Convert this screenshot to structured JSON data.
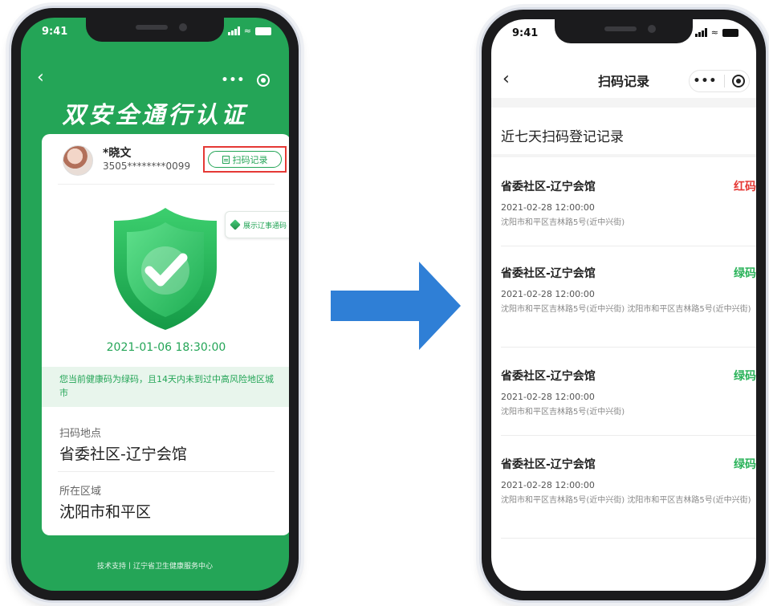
{
  "left_phone": {
    "status_time": "9:41",
    "title": "双安全通行认证",
    "user": {
      "name": "*晓文",
      "id_masked": "3505********0099"
    },
    "record_button_label": "扫码记录",
    "show_code_label": "展示辽事通码",
    "timestamp": "2021-01-06 18:30:00",
    "notice": "您当前健康码为绿码，且14天内未到过中高风险地区城市",
    "fields": [
      {
        "label": "扫码地点",
        "value": "省委社区-辽宁会馆"
      },
      {
        "label": "所在区域",
        "value": "沈阳市和平区"
      }
    ],
    "footer": "技术支持丨辽宁省卫生健康服务中心",
    "colors": {
      "brand_green": "#24a557",
      "highlight_red": "#e53935"
    }
  },
  "right_phone": {
    "status_time": "9:41",
    "nav_title": "扫码记录",
    "section_title": "近七天扫码登记记录",
    "records": [
      {
        "place": "省委社区-辽宁会馆",
        "status": "红码",
        "status_color": "#e53935",
        "time": "2021-02-28  12:00:00",
        "address": "沈阳市和平区吉林路5号(近中兴街)"
      },
      {
        "place": "省委社区-辽宁会馆",
        "status": "绿码",
        "status_color": "#2bb35a",
        "time": "2021-02-28  12:00:00",
        "address": "沈阳市和平区吉林路5号(近中兴街)  沈阳市和平区吉林路5号(近中兴街)"
      },
      {
        "place": "省委社区-辽宁会馆",
        "status": "绿码",
        "status_color": "#2bb35a",
        "time": "2021-02-28  12:00:00",
        "address": "沈阳市和平区吉林路5号(近中兴街)"
      },
      {
        "place": "省委社区-辽宁会馆",
        "status": "绿码",
        "status_color": "#2bb35a",
        "time": "2021-02-28  12:00:00",
        "address": "沈阳市和平区吉林路5号(近中兴街)  沈阳市和平区吉林路5号(近中兴街)"
      }
    ]
  },
  "arrow_color": "#2f7fd6"
}
